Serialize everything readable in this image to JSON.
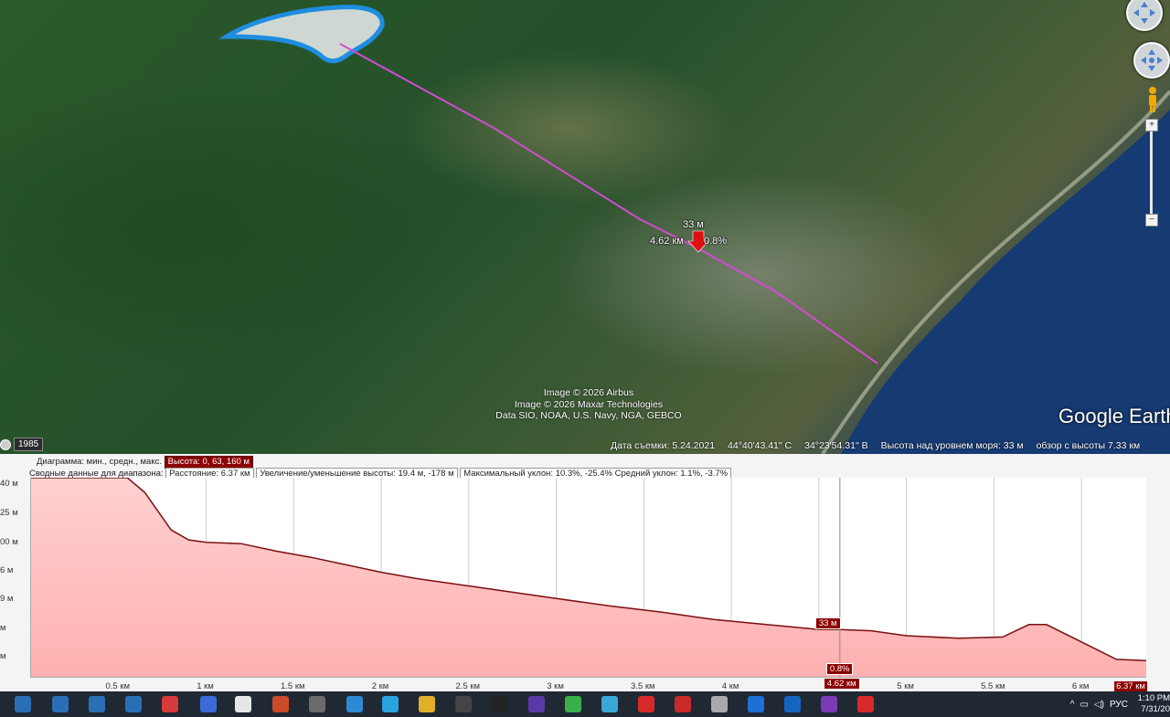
{
  "map": {
    "elevation_label": "33 м",
    "distance_label": "4.62 км",
    "slope_label": "0.8%",
    "attribution": [
      "Image © 2026 Airbus",
      "Image © 2026 Maxar Technologies",
      "Data SIO, NOAA, U.S. Navy, NGA, GEBCO"
    ],
    "logo": "Google Earth",
    "historical_year": "1985"
  },
  "statusbar": {
    "date": "Дата съемки: 5.24.2021",
    "lat": "44°40'43.41\" С",
    "lon": "34°23'54.31\" В",
    "elevation": "Высота над уровнем моря:     33 м",
    "eye_alt": "обзор с высоты    7.33 км"
  },
  "profile": {
    "row1_label": "Диаграмма: мин., средн., макс.",
    "row1_value": "Высота: 0, 63, 160 м",
    "row2_label": "Сводные данные для диапазона:",
    "row2_distance": "Расстояние: 6.37 км",
    "row2_gain": "Увеличение/уменьшение высоты: 19.4 м, -178 м",
    "row2_slope": "Максимальный уклон: 10.3%, -25.4% Средний уклон: 1.1%, -3.7%",
    "marker_elev": "33 м",
    "marker_slope": "0.8%",
    "marker_dist": "4.62 км"
  },
  "chart_data": {
    "type": "area",
    "xlabel": "",
    "ylabel": "",
    "x_unit": "км",
    "xlim": [
      0,
      6.37
    ],
    "x_ticks": [
      "0.5 км",
      "1 км",
      "1.5 км",
      "2 км",
      "2.5 км",
      "3 км",
      "3.5 км",
      "4 км",
      "4.5 км",
      "5 км",
      "5.5 км",
      "6 км"
    ],
    "x_tick_values": [
      0.5,
      1,
      1.5,
      2,
      2.5,
      3,
      3.5,
      4,
      4.5,
      5,
      5.5,
      6
    ],
    "x_end_label": "6.37 км",
    "y_ticks": [
      "40 м",
      "25 м",
      "00 м",
      "6 м",
      "9 м",
      "м",
      "м"
    ],
    "ylim": [
      0,
      160
    ],
    "x": [
      0,
      0.55,
      0.65,
      0.8,
      0.9,
      1.0,
      1.2,
      1.4,
      1.6,
      1.8,
      2.0,
      2.2,
      2.5,
      2.8,
      3.0,
      3.3,
      3.6,
      3.9,
      4.2,
      4.5,
      4.62,
      4.8,
      5.0,
      5.3,
      5.55,
      5.7,
      5.8,
      6.0,
      6.2,
      6.37
    ],
    "y": [
      160,
      160,
      148,
      118,
      110,
      108,
      107,
      101,
      96,
      90,
      84,
      79,
      73,
      67,
      63,
      57,
      52,
      46,
      42,
      38,
      38,
      37,
      33,
      31,
      32,
      42,
      42,
      28,
      14,
      13
    ],
    "marker_x": 4.62,
    "marker_y": 33
  },
  "taskbar": {
    "lang": "РУС",
    "time": "1:10 PM",
    "date": "7/31/20",
    "icons": [
      "app-1",
      "app-2",
      "app-3",
      "app-4",
      "colors",
      "eye",
      "document",
      "shield",
      "calendar",
      "remote",
      "telegram",
      "tool",
      "ur242",
      "obs",
      "media",
      "qgis",
      "image",
      "opera",
      "scaner",
      "browser-g",
      "edge",
      "edge2",
      "gem",
      "arrow"
    ]
  }
}
